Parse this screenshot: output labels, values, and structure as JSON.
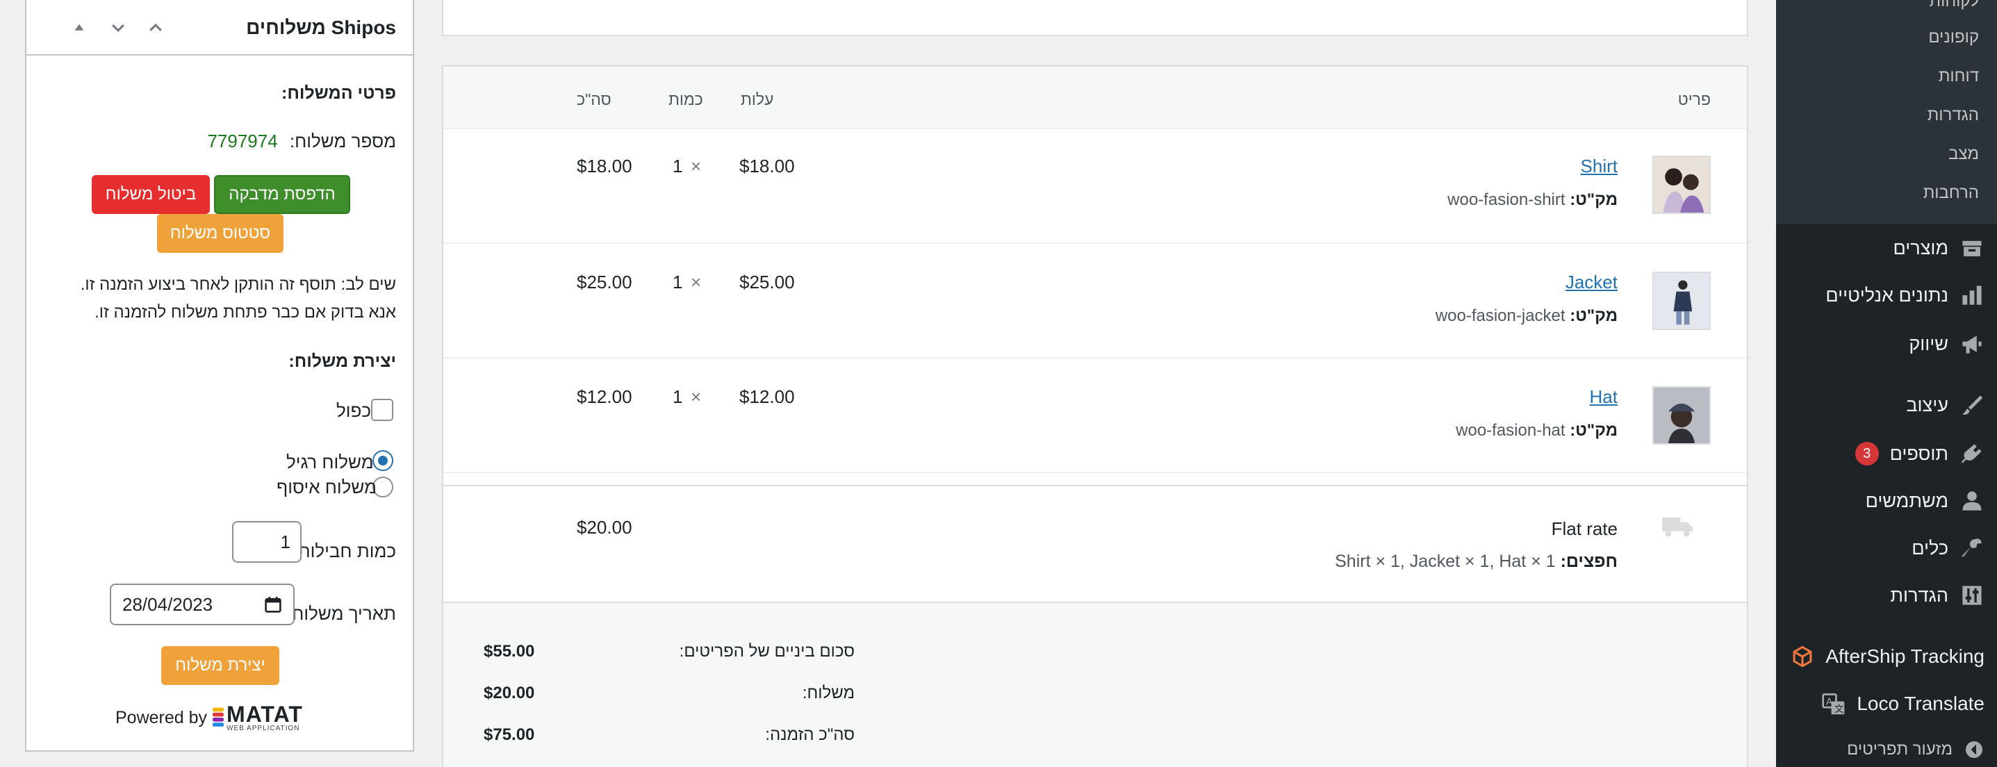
{
  "shipos": {
    "title": "Shipos משלוחים",
    "details_heading": "פרטי המשלוח:",
    "shipment_number_label": "מספר משלוח:",
    "shipment_number": "7797974",
    "print_label_button": "הדפסת מדבקה",
    "cancel_button": "ביטול משלוח",
    "status_button": "סטטוס משלוח",
    "note_line1": "שים לב: תוסף זה הותקן לאחר ביצוע הזמנה זו.",
    "note_line2": "אנא בדוק אם כבר פתחת משלוח להזמנה זו.",
    "create_heading": "יצירת משלוח:",
    "double_label": "כפול",
    "regular_label": "משלוח רגיל",
    "pickup_label": "משלוח איסוף",
    "packages_label": "כמות חבילות:",
    "packages_value": "1",
    "date_label": "תאריך משלוח:",
    "date_value": "28/04/2023",
    "create_button": "יצירת משלוח",
    "powered_by": "Powered by",
    "logo_text": "MATAT",
    "logo_sub": "WEB APPLICATION"
  },
  "order": {
    "headers": {
      "item": "פריט",
      "cost": "עלות",
      "qty": "כמות",
      "total": "סה\"כ"
    },
    "sku_label": "מק\"ט:",
    "times": "×",
    "items": [
      {
        "name": "Shirt",
        "sku": "woo-fasion-shirt",
        "cost": "$18.00",
        "qty": "1",
        "total": "$18.00"
      },
      {
        "name": "Jacket",
        "sku": "woo-fasion-jacket",
        "cost": "$25.00",
        "qty": "1",
        "total": "$25.00"
      },
      {
        "name": "Hat",
        "sku": "woo-fasion-hat",
        "cost": "$12.00",
        "qty": "1",
        "total": "$12.00"
      }
    ],
    "shipping": {
      "method": "Flat rate",
      "items_label": "חפצים:",
      "items_value": "Shirt × 1, Jacket × 1, Hat × 1",
      "total": "$20.00"
    },
    "totals": {
      "subtotal_label": "סכום ביניים של הפריטים:",
      "subtotal": "$55.00",
      "shipping_label": "משלוח:",
      "shipping": "$20.00",
      "order_total_label": "סה\"כ הזמנה:",
      "order_total": "$75.00"
    }
  },
  "admin_menu": {
    "submenu": [
      "לקוחות",
      "קופונים",
      "דוחות",
      "הגדרות",
      "מצב",
      "הרחבות"
    ],
    "items": [
      {
        "label": "מוצרים",
        "icon": "archive-icon"
      },
      {
        "label": "נתונים אנליטיים",
        "icon": "chart-bar-icon"
      },
      {
        "label": "שיווק",
        "icon": "megaphone-icon"
      },
      {
        "label": "עיצוב",
        "icon": "paintbrush-icon"
      },
      {
        "label": "תוספים",
        "icon": "plugin-icon",
        "badge": "3"
      },
      {
        "label": "משתמשים",
        "icon": "user-icon"
      },
      {
        "label": "כלים",
        "icon": "wrench-icon"
      },
      {
        "label": "הגדרות",
        "icon": "settings-sliders-icon"
      }
    ],
    "aftership": "AfterShip Tracking",
    "loco": "Loco Translate",
    "collapse": "מזעור תפריטים"
  }
}
